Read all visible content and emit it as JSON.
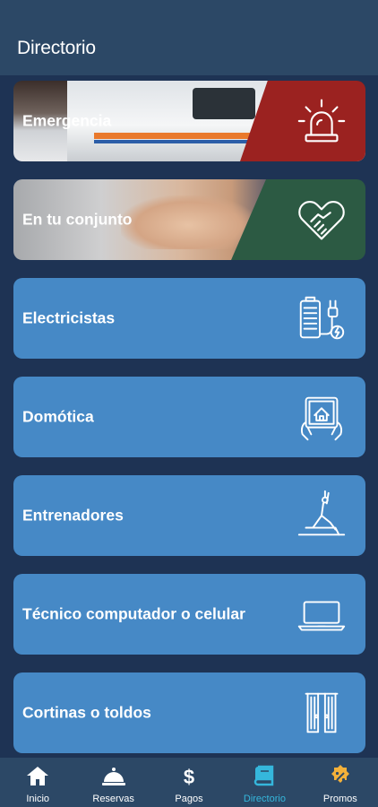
{
  "header": {
    "title": "Directorio"
  },
  "cards": [
    {
      "label": "Emergencia",
      "icon": "alarm-siren-icon"
    },
    {
      "label": "En tu conjunto",
      "icon": "heart-handshake-icon"
    },
    {
      "label": "Electricistas",
      "icon": "battery-plug-icon"
    },
    {
      "label": "Domótica",
      "icon": "smart-home-tablet-icon"
    },
    {
      "label": "Entrenadores",
      "icon": "yoga-pose-icon"
    },
    {
      "label": "Técnico computador o celular",
      "icon": "laptop-icon"
    },
    {
      "label": "Cortinas o toldos",
      "icon": "curtains-icon"
    }
  ],
  "bottom_nav": [
    {
      "label": "Inicio",
      "icon": "home-icon"
    },
    {
      "label": "Reservas",
      "icon": "service-bell-icon"
    },
    {
      "label": "Pagos",
      "icon": "dollar-icon"
    },
    {
      "label": "Directorio",
      "icon": "book-icon",
      "active": true
    },
    {
      "label": "Promos",
      "icon": "discount-badge-icon"
    }
  ],
  "colors": {
    "background": "#1e3354",
    "header": "#2c4866",
    "card": "#4689c6",
    "emergency_panel": "#9b2220",
    "community_panel": "#2c5a43",
    "nav_active": "#35b7dc",
    "promo_icon": "#f4b13a"
  }
}
